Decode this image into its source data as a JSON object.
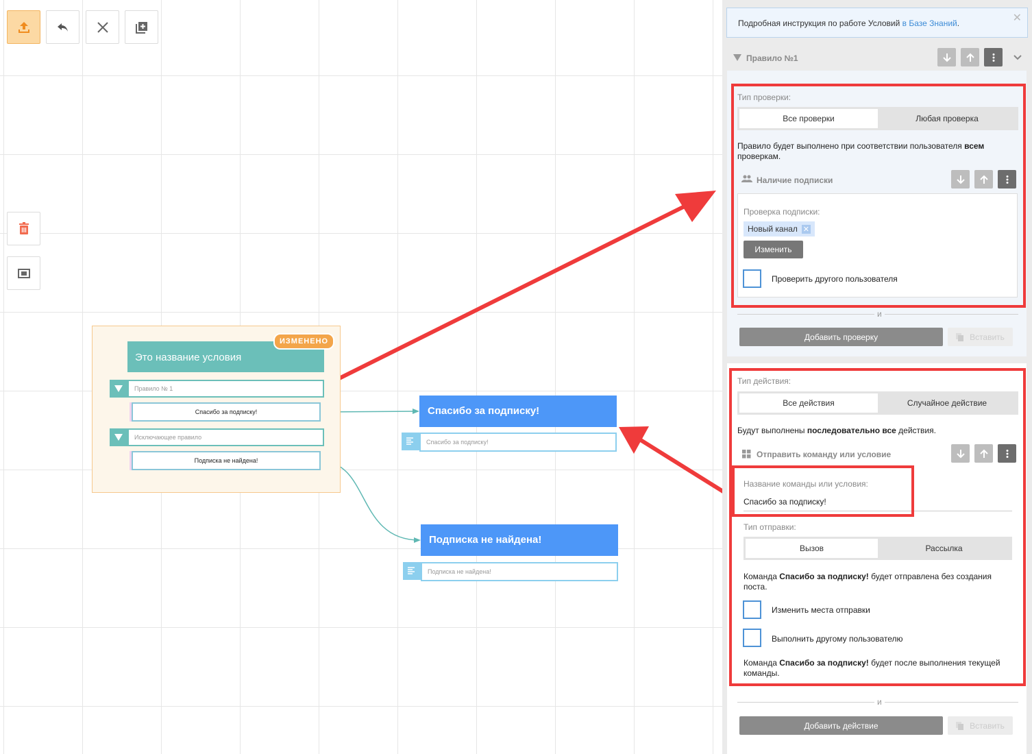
{
  "toolbar": {
    "upload_icon": "upload-icon",
    "undo_icon": "undo-icon",
    "close_icon": "close-icon",
    "add_icon": "add-block-icon"
  },
  "side_tools": {
    "trash_icon": "trash-icon",
    "fit_icon": "fit-screen-icon"
  },
  "canvas": {
    "condition": {
      "title": "Это название условия",
      "badge": "ИЗМЕНЕНО",
      "rules": [
        {
          "label": "Правило № 1",
          "item": "Спасибо за подписку!"
        },
        {
          "label": "Исключающее правило",
          "item": "Подписка не найдена!"
        }
      ]
    },
    "commands": [
      {
        "title": "Спасибо за подписку!",
        "sub": "Спасибо за подписку!"
      },
      {
        "title": "Подписка не найдена!",
        "sub": "Подписка не найдена!"
      }
    ]
  },
  "panel": {
    "info": {
      "text": "Подробная инструкция по работе Условий ",
      "link": "в Базе Знаний",
      "tail": "."
    },
    "rule_title": "Правило  №1",
    "check_type": {
      "label": "Тип проверки:",
      "options": [
        "Все проверки",
        "Любая проверка"
      ],
      "selected": "Все проверки",
      "desc_pre": "Правило будет выполнено при соответствии пользователя ",
      "desc_bold": "всем",
      "desc_post": " проверкам."
    },
    "subscription": {
      "title": "Наличие подписки",
      "check_label": "Проверка подписки:",
      "chip": "Новый канал",
      "change_button": "Изменить",
      "other_user": "Проверить другого пользователя"
    },
    "and_label": "и",
    "add_check": "Добавить проверку",
    "paste": "Вставить",
    "action_type": {
      "label": "Тип действия:",
      "options": [
        "Все действия",
        "Случайное действие"
      ],
      "selected": "Все действия",
      "desc_pre": "Будут выполнены ",
      "desc_bold": "последовательно все",
      "desc_post": " действия."
    },
    "send_command": {
      "title": "Отправить команду или условие",
      "name_label": "Название команды или условия:",
      "name_value": "Спасибо за подписку!",
      "send_type_label": "Тип отправки:",
      "send_options": [
        "Вызов",
        "Рассылка"
      ],
      "send_selected": "Вызов",
      "desc1_pre": "Команда ",
      "desc1_bold": "Спасибо за подписку!",
      "desc1_post": " будет отправлена без создания поста.",
      "change_places": "Изменить места отправки",
      "other_user": "Выполнить другому пользователю",
      "desc2_pre": "Команда ",
      "desc2_bold": "Спасибо за подписку!",
      "desc2_post": " будет после выполнения текущей команды."
    },
    "add_action": "Добавить действие",
    "paste2": "Вставить"
  },
  "colors": {
    "teal": "#6bbfb9",
    "blue": "#4d97f8",
    "orange": "#f3a54a",
    "red": "#ef3b3b"
  }
}
